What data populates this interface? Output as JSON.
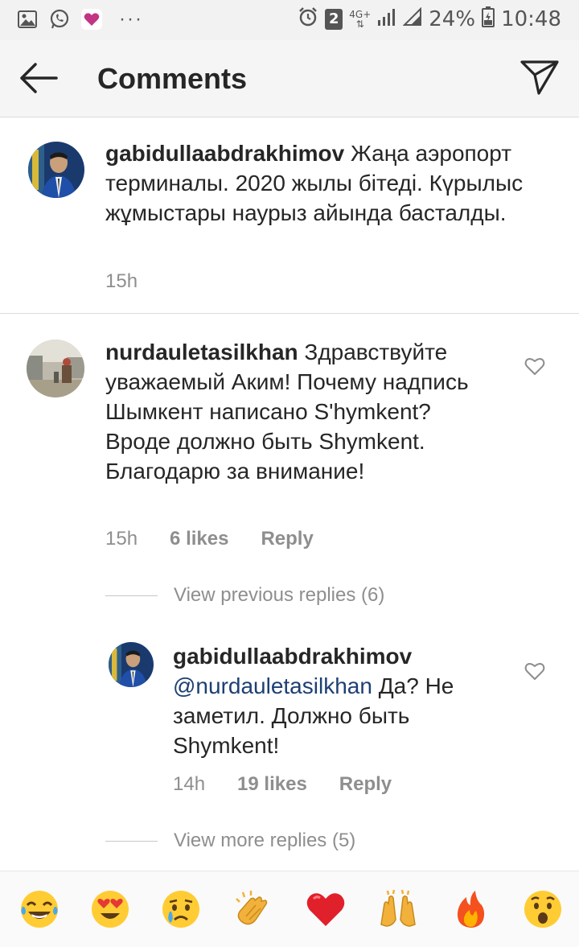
{
  "status_bar": {
    "sim_badge": "2",
    "network": "4G+",
    "battery": "24%",
    "time": "10:48",
    "dots": "···",
    "icons": [
      "gallery-icon",
      "whatsapp-icon",
      "heart-app-icon"
    ]
  },
  "header": {
    "title": "Comments",
    "back_icon": "back-arrow-icon",
    "send_icon": "send-icon"
  },
  "caption": {
    "username": "gabidullaabdrakhimov",
    "text": " Жаңа аэропорт терминалы. 2020 жылы бітеді. Күрылыс жұмыстары наурыз айында басталды.",
    "time": "15h"
  },
  "comment1": {
    "username": "nurdauletasilkhan",
    "text": " Здравствуйте уважаемый Аким! Почему надпись Шымкент написано S'hymkent? Вроде должно быть Shymkent. Благодарю за внимание!",
    "time": "15h",
    "likes": "6 likes",
    "reply": "Reply"
  },
  "view_previous": "View previous replies (6)",
  "reply1": {
    "username": "gabidullaabdrakhimov",
    "mention": "@nurdauletasilkhan",
    "text": " Да? Не заметил. Должно быть Shymkent!",
    "time": "14h",
    "likes": "19 likes",
    "reply": "Reply"
  },
  "view_more": "View more replies (5)",
  "emoji_bar": [
    "😂",
    "😍",
    "😢",
    "👏",
    "❤️",
    "🙌",
    "🔥",
    "😮"
  ],
  "colors": {
    "mention": "#1d3f73",
    "muted": "#8e8e8e",
    "text": "#262626"
  }
}
